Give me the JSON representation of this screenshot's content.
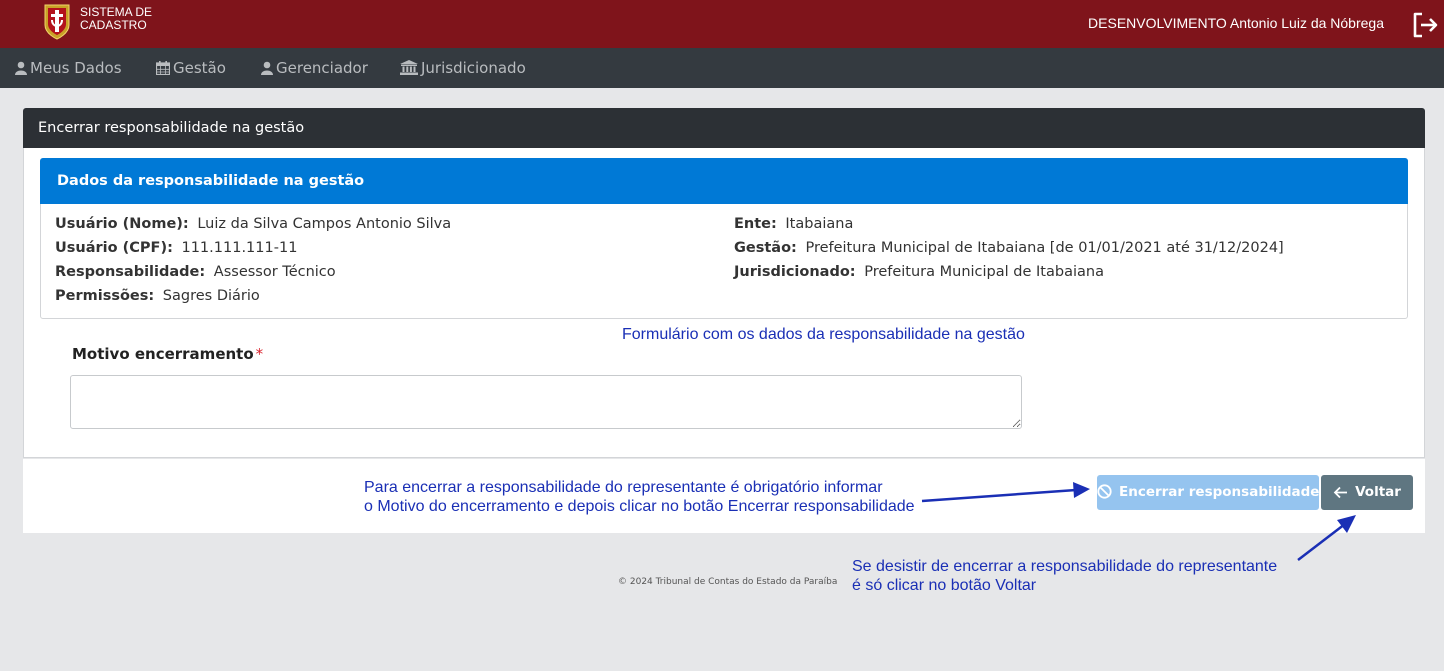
{
  "header": {
    "brand_line1": "SISTEMA DE",
    "brand_line2": "CADASTRO",
    "user": "DESENVOLVIMENTO Antonio Luiz da Nóbrega",
    "logo_icon": "crest-logo-icon",
    "logout_icon": "logout-icon"
  },
  "nav": {
    "items": [
      {
        "label": "Meus Dados",
        "icon": "user-icon"
      },
      {
        "label": "Gestão",
        "icon": "calendar-icon"
      },
      {
        "label": "Gerenciador",
        "icon": "user-icon"
      },
      {
        "label": "Jurisdicionado",
        "icon": "bank-icon"
      }
    ]
  },
  "card": {
    "title": "Encerrar responsabilidade na gestão",
    "inner_title": "Dados da responsabilidade na gestão",
    "fields_left": [
      {
        "label": "Usuário (Nome):",
        "value": "Luiz da Silva Campos Antonio Silva"
      },
      {
        "label": "Usuário (CPF):",
        "value": "111.111.111-11"
      },
      {
        "label": "Responsabilidade:",
        "value": "Assessor Técnico"
      },
      {
        "label": "Permissões:",
        "value": "Sagres Diário"
      }
    ],
    "fields_right": [
      {
        "label": "Ente:",
        "value": "Itabaiana"
      },
      {
        "label": "Gestão:",
        "value": "Prefeitura Municipal de Itabaiana [de 01/01/2021 até 31/12/2024]"
      },
      {
        "label": "Jurisdicionado:",
        "value": "Prefeitura Municipal de Itabaiana"
      }
    ],
    "motivo_label": "Motivo encerramento",
    "required_mark": "*",
    "motivo_value": "",
    "btn_encerrar": "Encerrar responsabilidade",
    "btn_voltar": "Voltar"
  },
  "annotations": {
    "form_note": "Formulário com os dados da responsabilidade na gestão",
    "encerrar_note_line1": "Para encerrar a responsabilidade do representante é obrigatório informar",
    "encerrar_note_line2": "o Motivo do encerramento e depois clicar no botão Encerrar responsabilidade",
    "voltar_note_line1": "Se desistir de encerrar a responsabilidade do representante",
    "voltar_note_line2": "é só clicar no botão Voltar"
  },
  "footer": {
    "copyright": "© 2024 Tribunal de Contas do Estado da Paraíba"
  },
  "colors": {
    "header_bg": "#7f141b",
    "nav_bg": "#343a40",
    "card_header_bg": "#2c3035",
    "inner_header_bg": "#0079d6",
    "btn_encerrar_bg": "#95c4ef",
    "btn_voltar_bg": "#5f7681",
    "annotation_blue": "#1a2fb5",
    "required_red": "#d9232e"
  }
}
